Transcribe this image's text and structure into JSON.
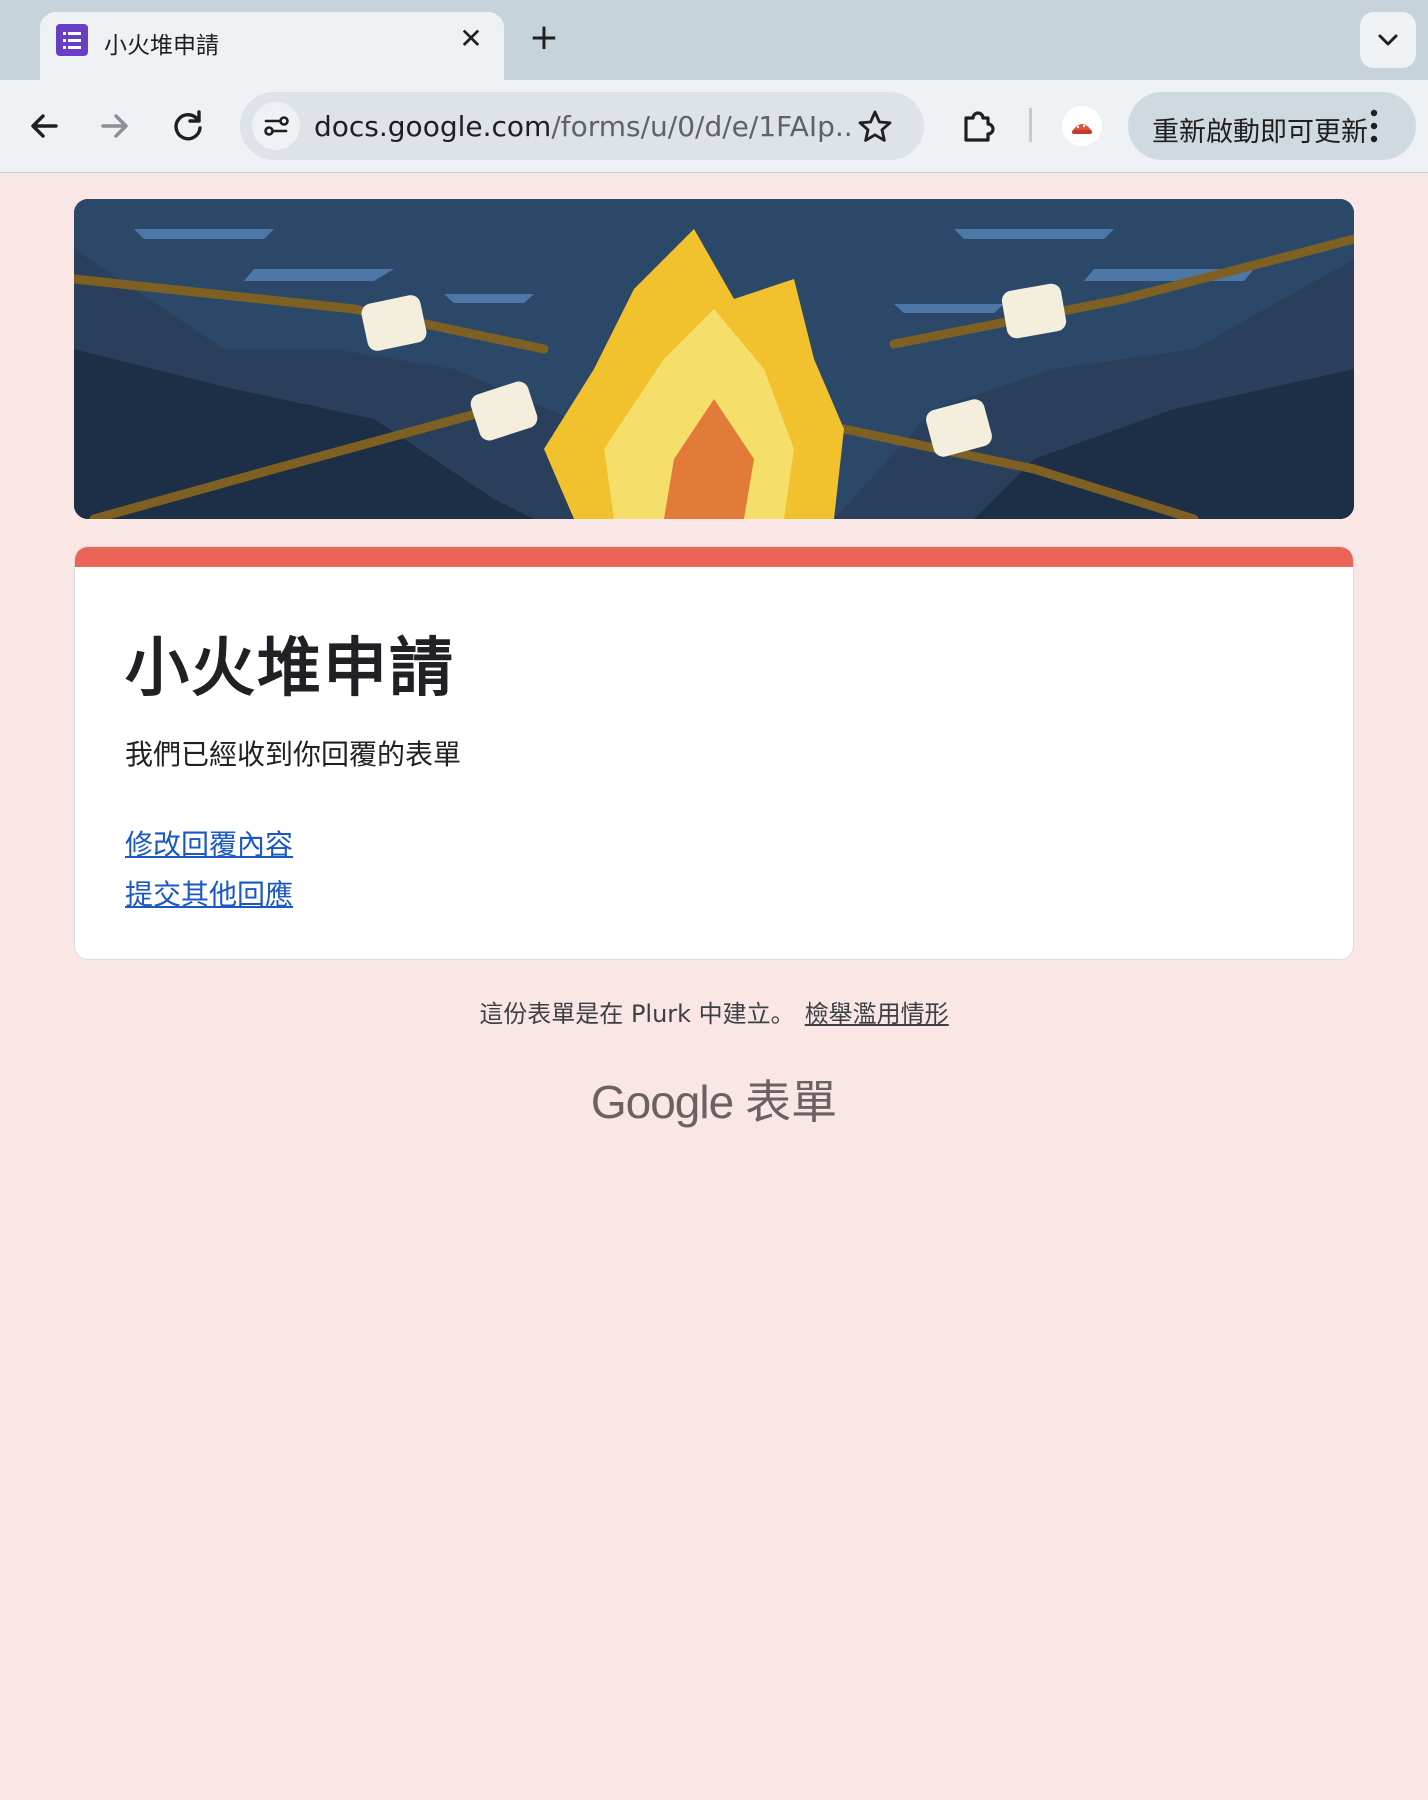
{
  "browser": {
    "tab_title": "小火堆申請",
    "tab_close": "✕",
    "new_tab": "+",
    "url_host": "docs.google.com",
    "url_path": "/forms/u/0/d/e/1FAIp...",
    "update_button_label": "重新啟動即可更新",
    "icons": [
      "forms-icon",
      "close-icon",
      "plus-icon",
      "chevron-down-icon",
      "back-arrow-icon",
      "forward-arrow-icon",
      "reload-icon",
      "site-info-icon",
      "star-icon",
      "extensions-icon",
      "profile-avatar",
      "more-vert-icon"
    ]
  },
  "form": {
    "title": "小火堆申請",
    "confirmation": "我們已經收到你回覆的表單",
    "edit_link": "修改回覆內容",
    "another_link": "提交其他回應",
    "accent_color": "#ea6457"
  },
  "footer": {
    "created_text": "這份表單是在 Plurk 中建立。",
    "report_link": "檢舉濫用情形",
    "brand_google": "Google",
    "brand_product": "表單"
  }
}
